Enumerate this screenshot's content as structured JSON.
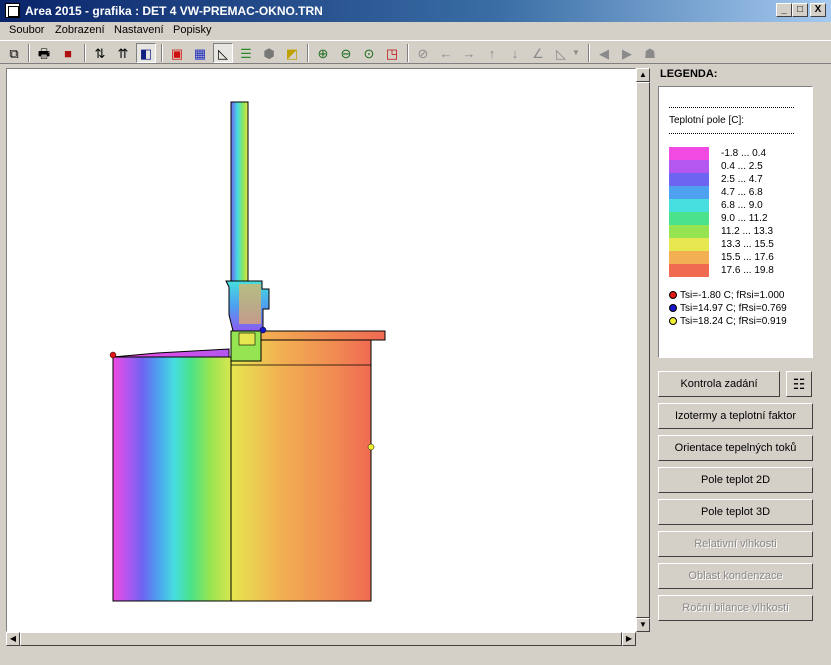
{
  "window": {
    "title": "Area 2015 - grafika : DET 4 VW-PREMAC-OKNO.TRN",
    "minimize": "_",
    "maximize": "□",
    "close": "X"
  },
  "menu": [
    "Soubor",
    "Zobrazení",
    "Nastavení",
    "Popisky"
  ],
  "legend": {
    "heading": "LEGENDA:",
    "field_label": "Teplotní pole [C]:",
    "ranges": [
      "-1.8 ... 0.4",
      "0.4 ... 2.5",
      "2.5 ... 4.7",
      "4.7 ... 6.8",
      "6.8 ... 9.0",
      "9.0 ... 11.2",
      "11.2 ... 13.3",
      "13.3 ... 15.5",
      "15.5 ... 17.6",
      "17.6 ... 19.8"
    ],
    "colors": [
      "#f04ae0",
      "#b456f0",
      "#6e64f2",
      "#4ea0f0",
      "#46dede",
      "#4ae28a",
      "#96e452",
      "#e6e650",
      "#f2b052",
      "#f06a52"
    ],
    "points": [
      {
        "color": "#e01818",
        "text": "Tsi=-1.80 C; fRsi=1.000"
      },
      {
        "color": "#1818c8",
        "text": "Tsi=14.97 C; fRsi=0.769"
      },
      {
        "color": "#f0f030",
        "text": "Tsi=18.24 C; fRsi=0.919"
      }
    ]
  },
  "buttons": {
    "kontrola": "Kontrola zadání",
    "izotermy": "Izotermy a teplotní faktor",
    "orientace": "Orientace tepelných toků",
    "pole2d": "Pole teplot 2D",
    "pole3d": "Pole teplot 3D",
    "relativni": "Relativní vlhkosti",
    "oblast": "Oblast kondenzace",
    "rocni": "Roční bilance vlhkosti"
  }
}
